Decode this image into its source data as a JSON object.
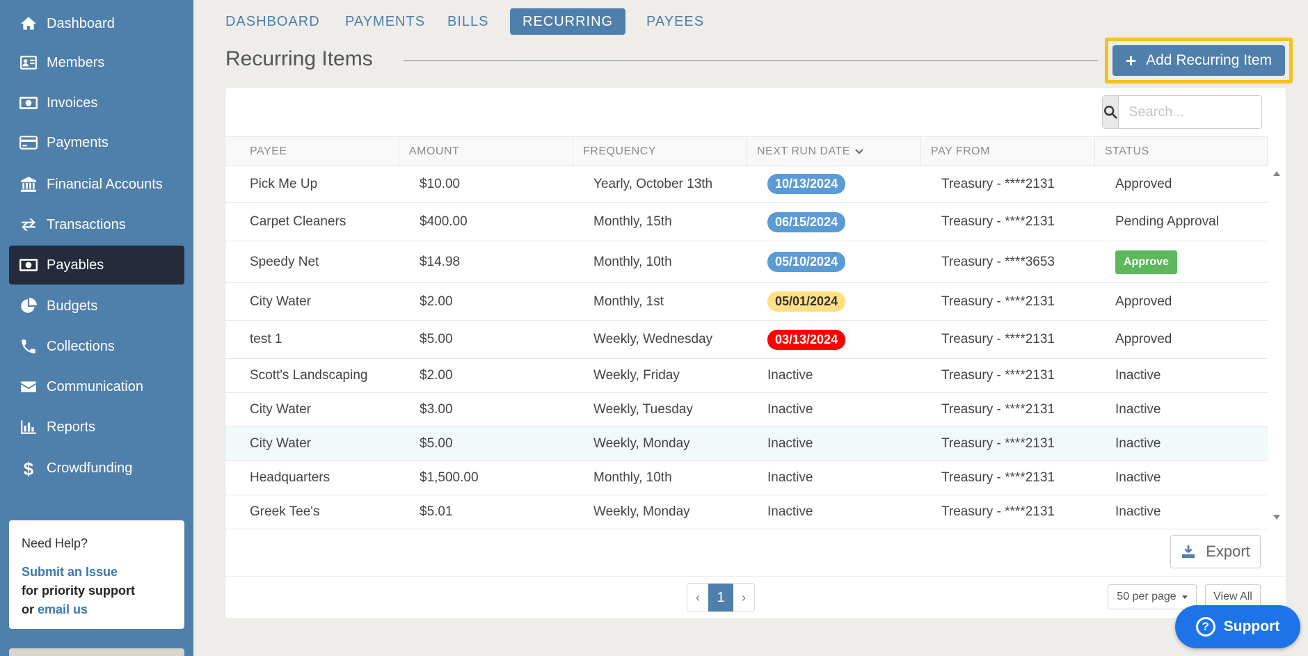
{
  "sidebar": {
    "items": [
      {
        "label": "Dashboard",
        "icon": "home-icon"
      },
      {
        "label": "Members",
        "icon": "id-card-icon"
      },
      {
        "label": "Invoices",
        "icon": "money-bill-icon"
      },
      {
        "label": "Payments",
        "icon": "credit-card-icon"
      },
      {
        "label": "Financial Accounts",
        "icon": "bank-icon"
      },
      {
        "label": "Transactions",
        "icon": "exchange-icon"
      },
      {
        "label": "Payables",
        "icon": "money-bill-icon",
        "active": true
      },
      {
        "label": "Budgets",
        "icon": "pie-chart-icon"
      },
      {
        "label": "Collections",
        "icon": "phone-icon"
      },
      {
        "label": "Communication",
        "icon": "envelope-icon"
      },
      {
        "label": "Reports",
        "icon": "bar-chart-icon"
      },
      {
        "label": "Crowdfunding",
        "icon": "dollar-icon"
      }
    ],
    "help": {
      "title": "Need Help?",
      "submit_link": "Submit an Issue",
      "priority_text": "for priority support",
      "or_text": "or",
      "email_link": "email us"
    }
  },
  "tabs": [
    {
      "label": "DASHBOARD"
    },
    {
      "label": "PAYMENTS"
    },
    {
      "label": "BILLS"
    },
    {
      "label": "RECURRING",
      "active": true
    },
    {
      "label": "PAYEES"
    }
  ],
  "page": {
    "title": "Recurring Items",
    "add_button": "Add Recurring Item"
  },
  "search": {
    "placeholder": "Search..."
  },
  "table": {
    "columns": [
      "PAYEE",
      "AMOUNT",
      "FREQUENCY",
      "NEXT RUN DATE",
      "PAY FROM",
      "STATUS"
    ],
    "sorted_column": "NEXT RUN DATE",
    "rows": [
      {
        "payee": "Pick Me Up",
        "amount": "$10.00",
        "frequency": "Yearly, October 13th",
        "next_run": "10/13/2024",
        "next_run_style": "blue",
        "pay_from": "Treasury - ****2131",
        "status": "Approved",
        "status_type": "text"
      },
      {
        "payee": "Carpet Cleaners",
        "amount": "$400.00",
        "frequency": "Monthly, 15th",
        "next_run": "06/15/2024",
        "next_run_style": "blue",
        "pay_from": "Treasury - ****2131",
        "status": "Pending Approval",
        "status_type": "text"
      },
      {
        "payee": "Speedy Net",
        "amount": "$14.98",
        "frequency": "Monthly, 10th",
        "next_run": "05/10/2024",
        "next_run_style": "blue",
        "pay_from": "Treasury - ****3653",
        "status": "Approve",
        "status_type": "button"
      },
      {
        "payee": "City Water",
        "amount": "$2.00",
        "frequency": "Monthly, 1st",
        "next_run": "05/01/2024",
        "next_run_style": "yellow",
        "pay_from": "Treasury - ****2131",
        "status": "Approved",
        "status_type": "text"
      },
      {
        "payee": "test 1",
        "amount": "$5.00",
        "frequency": "Weekly, Wednesday",
        "next_run": "03/13/2024",
        "next_run_style": "red",
        "pay_from": "Treasury - ****2131",
        "status": "Approved",
        "status_type": "text"
      },
      {
        "payee": "Scott's Landscaping",
        "amount": "$2.00",
        "frequency": "Weekly, Friday",
        "next_run": "Inactive",
        "next_run_style": "text",
        "pay_from": "Treasury - ****2131",
        "status": "Inactive",
        "status_type": "text"
      },
      {
        "payee": "City Water",
        "amount": "$3.00",
        "frequency": "Weekly, Tuesday",
        "next_run": "Inactive",
        "next_run_style": "text",
        "pay_from": "Treasury - ****2131",
        "status": "Inactive",
        "status_type": "text"
      },
      {
        "payee": "City Water",
        "amount": "$5.00",
        "frequency": "Weekly, Monday",
        "next_run": "Inactive",
        "next_run_style": "text",
        "pay_from": "Treasury - ****2131",
        "status": "Inactive",
        "status_type": "text",
        "highlight": true
      },
      {
        "payee": "Headquarters",
        "amount": "$1,500.00",
        "frequency": "Monthly, 10th",
        "next_run": "Inactive",
        "next_run_style": "text",
        "pay_from": "Treasury - ****2131",
        "status": "Inactive",
        "status_type": "text"
      },
      {
        "payee": "Greek Tee's",
        "amount": "$5.01",
        "frequency": "Weekly, Monday",
        "next_run": "Inactive",
        "next_run_style": "text",
        "pay_from": "Treasury - ****2131",
        "status": "Inactive",
        "status_type": "text"
      }
    ]
  },
  "footer": {
    "export_label": "Export",
    "current_page": "1",
    "prev": "‹",
    "next": "›",
    "per_page": "50 per page",
    "view_all": "View All"
  },
  "support": {
    "label": "Support",
    "glyph": "?"
  },
  "colors": {
    "sidebar": "#4f7fab",
    "active_nav": "#252b3b",
    "highlight_border": "#f6c11a",
    "badge_blue": "#5b9bd5",
    "badge_yellow": "#ffe082",
    "badge_red": "#ff0000",
    "approve_green": "#5cb85c",
    "support_blue": "#1e73e8"
  }
}
